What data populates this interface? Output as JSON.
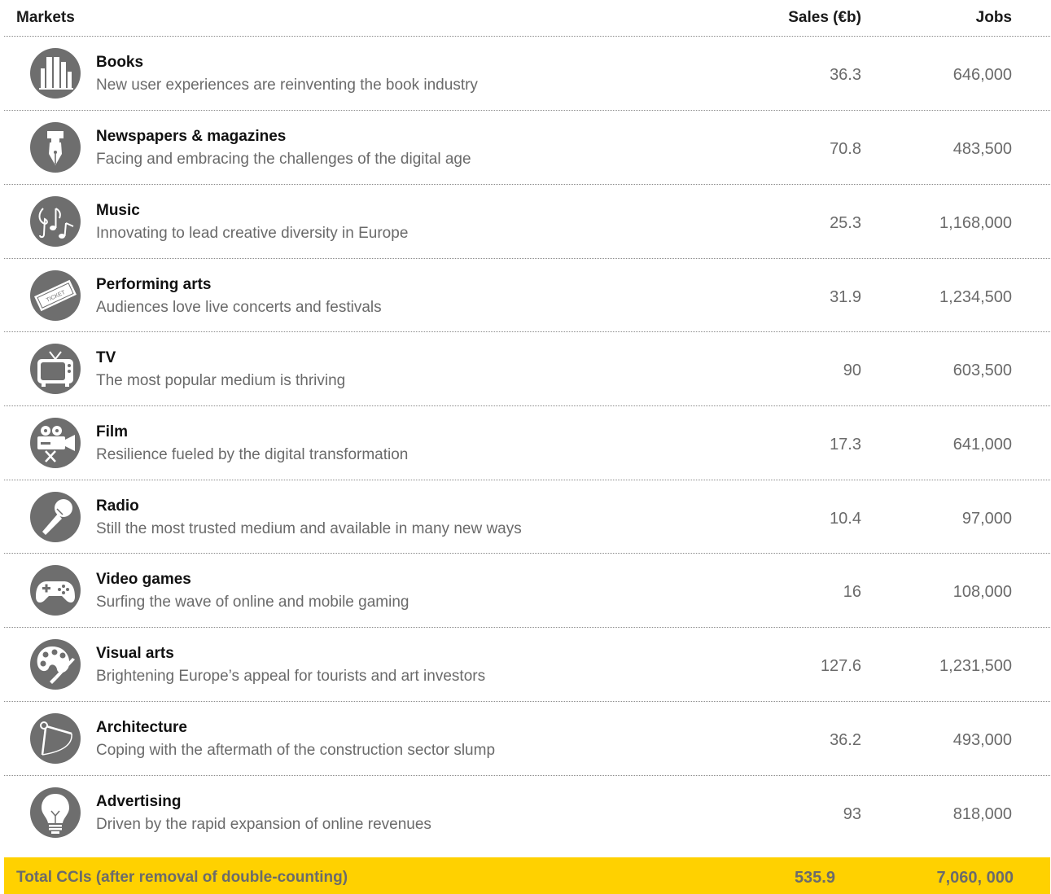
{
  "header": {
    "markets_label": "Markets",
    "sales_label": "Sales (€b)",
    "jobs_label": "Jobs"
  },
  "rows": [
    {
      "icon": "books-icon",
      "name": "Books",
      "desc": "New user experiences are reinventing the book industry",
      "sales": "36.3",
      "jobs": "646,000"
    },
    {
      "icon": "fountain-pen-icon",
      "name": "Newspapers & magazines",
      "desc": "Facing and embracing the challenges of the digital age",
      "sales": "70.8",
      "jobs": "483,500"
    },
    {
      "icon": "music-notes-icon",
      "name": "Music",
      "desc": "Innovating to lead creative diversity in Europe",
      "sales": "25.3",
      "jobs": "1,168,000"
    },
    {
      "icon": "ticket-icon",
      "icon_text": "TICKET",
      "name": "Performing arts",
      "desc": "Audiences love live concerts and festivals",
      "sales": "31.9",
      "jobs": "1,234,500"
    },
    {
      "icon": "tv-icon",
      "name": "TV",
      "desc": "The most popular medium is thriving",
      "sales": "90",
      "jobs": "603,500"
    },
    {
      "icon": "film-camera-icon",
      "name": "Film",
      "desc": "Resilience fueled by the digital transformation",
      "sales": "17.3",
      "jobs": "641,000"
    },
    {
      "icon": "microphone-icon",
      "name": "Radio",
      "desc": "Still the most trusted medium and available in many new ways",
      "sales": "10.4",
      "jobs": "97,000"
    },
    {
      "icon": "gamepad-icon",
      "name": "Video games",
      "desc": "Surfing the wave of online and mobile gaming",
      "sales": "16",
      "jobs": "108,000"
    },
    {
      "icon": "palette-icon",
      "name": "Visual arts",
      "desc": "Brightening Europe’s appeal for tourists and art investors",
      "sales": "127.6",
      "jobs": "1,231,500"
    },
    {
      "icon": "compass-icon",
      "name": "Architecture",
      "desc": "Coping with the aftermath of the construction sector slump",
      "sales": "36.2",
      "jobs": "493,000"
    },
    {
      "icon": "lightbulb-icon",
      "name": "Advertising",
      "desc": "Driven by the rapid expansion of online revenues",
      "sales": "93",
      "jobs": "818,000"
    }
  ],
  "total": {
    "label": "Total CCIs (after removal of double-counting)",
    "sales": "535.9",
    "jobs": "7,060, 000"
  },
  "colors": {
    "icon_circle": "#6e6e6e",
    "total_bar": "#ffd100",
    "text_muted": "#6a6a6a"
  }
}
